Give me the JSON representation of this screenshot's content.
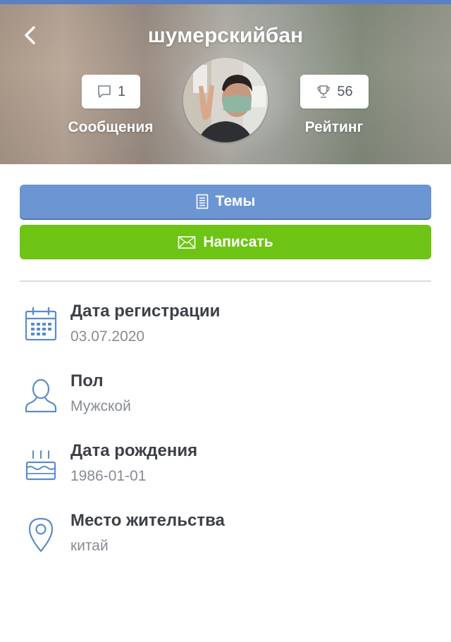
{
  "header": {
    "title": "шумерскийбан",
    "back_icon": "arrow-left-icon",
    "messages": {
      "count": "1",
      "label": "Сообщения",
      "icon": "speech-bubble-icon"
    },
    "rating": {
      "count": "56",
      "label": "Рейтинг",
      "icon": "trophy-icon"
    }
  },
  "actions": {
    "topics_label": "Темы",
    "topics_icon": "document-icon",
    "write_label": "Написать",
    "write_icon": "envelope-icon"
  },
  "info": {
    "registration": {
      "label": "Дата регистрации",
      "value": "03.07.2020",
      "icon": "calendar-icon"
    },
    "gender": {
      "label": "Пол",
      "value": "Мужской",
      "icon": "user-icon"
    },
    "birthday": {
      "label": "Дата рождения",
      "value": "1986-01-01",
      "icon": "cake-icon"
    },
    "location": {
      "label": "Место жительства",
      "value": "китай",
      "icon": "location-pin-icon"
    }
  },
  "colors": {
    "top_bar": "#5b7fc0",
    "topics_button": "#6b96d3",
    "write_button": "#6ec415",
    "icon_accent": "#5a8ec6",
    "label_text": "#3d4147",
    "value_text": "#878c93"
  }
}
